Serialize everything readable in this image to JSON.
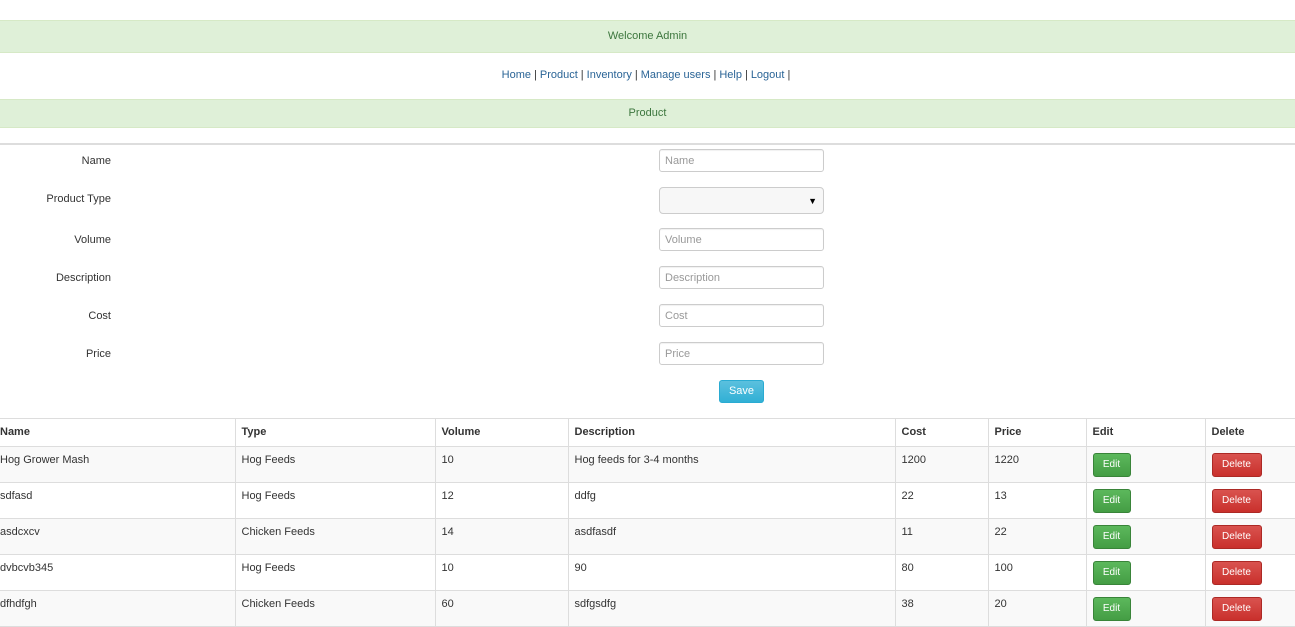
{
  "header": {
    "welcome": "Welcome Admin",
    "section_title": "Product"
  },
  "nav": {
    "items": [
      {
        "label": "Home"
      },
      {
        "label": "Product"
      },
      {
        "label": "Inventory"
      },
      {
        "label": "Manage users"
      },
      {
        "label": "Help"
      },
      {
        "label": "Logout"
      }
    ],
    "separator": "|"
  },
  "form": {
    "name": {
      "label": "Name",
      "placeholder": "Name",
      "value": ""
    },
    "product_type": {
      "label": "Product Type",
      "value": ""
    },
    "volume": {
      "label": "Volume",
      "placeholder": "Volume",
      "value": ""
    },
    "description": {
      "label": "Description",
      "placeholder": "Description",
      "value": ""
    },
    "cost": {
      "label": "Cost",
      "placeholder": "Cost",
      "value": ""
    },
    "price": {
      "label": "Price",
      "placeholder": "Price",
      "value": ""
    },
    "save_label": "Save"
  },
  "table": {
    "columns": [
      "Name",
      "Type",
      "Volume",
      "Description",
      "Cost",
      "Price",
      "Edit",
      "Delete"
    ],
    "rows": [
      {
        "name": "Hog Grower Mash",
        "type": "Hog Feeds",
        "volume": "10",
        "description": "Hog feeds for 3-4 months",
        "cost": "1200",
        "price": "1220"
      },
      {
        "name": "sdfasd",
        "type": "Hog Feeds",
        "volume": "12",
        "description": "ddfg",
        "cost": "22",
        "price": "13"
      },
      {
        "name": "asdcxcv",
        "type": "Chicken Feeds",
        "volume": "14",
        "description": "asdfasdf",
        "cost": "11",
        "price": "22"
      },
      {
        "name": "dvbcvb345",
        "type": "Hog Feeds",
        "volume": "10",
        "description": "90",
        "cost": "80",
        "price": "100"
      },
      {
        "name": "dfhdfgh",
        "type": "Chicken Feeds",
        "volume": "60",
        "description": "sdfgsdfg",
        "cost": "38",
        "price": "20"
      }
    ],
    "edit_label": "Edit",
    "delete_label": "Delete"
  },
  "colors": {
    "banner_bg": "#dff0d8",
    "banner_text": "#3c763d",
    "link": "#2a6496",
    "save_button": "#5bc0de",
    "edit_button": "#5cb85c",
    "delete_button": "#d9534f"
  },
  "icons": {
    "select_caret": "caret-down-icon"
  }
}
